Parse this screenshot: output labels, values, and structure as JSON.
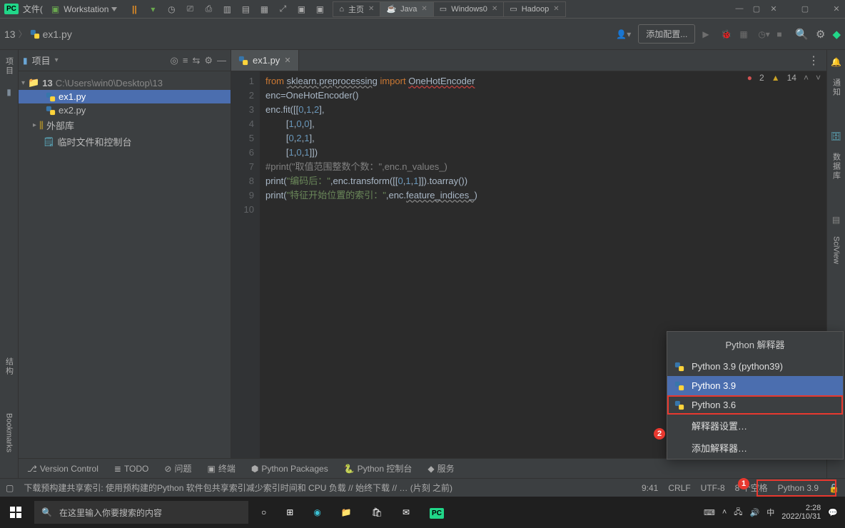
{
  "host_titlebar": {
    "pc_badge": "PC",
    "file_label": "文件("
  },
  "top_tabs": {
    "workstation": {
      "label": "Workstation",
      "has_dropdown": true
    },
    "icons": [
      "pause",
      "resume",
      "clock-icon",
      "picture-icon",
      "printer-icon",
      "layout1-icon",
      "layout2-icon",
      "layout3-icon",
      "expand-icon",
      "terminal1-icon",
      "terminal2-icon"
    ],
    "tabs": [
      {
        "label": "主页",
        "icon": "home-icon",
        "active": false
      },
      {
        "label": "Java",
        "icon": "java-icon",
        "active": true
      },
      {
        "label": "Windows0",
        "icon": "window-icon",
        "active": false
      },
      {
        "label": "Hadoop",
        "icon": "hadoop-icon",
        "active": false
      }
    ]
  },
  "breadcrumb": {
    "root": "13",
    "file": "ex1.py"
  },
  "toolbar": {
    "add_config": "添加配置..."
  },
  "project_panel": {
    "title": "项目",
    "root": {
      "name": "13",
      "path": "C:\\Users\\win0\\Desktop\\13"
    },
    "files": [
      "ex1.py",
      "ex2.py"
    ],
    "ext_lib": "外部库",
    "scratch": "临时文件和控制台"
  },
  "editor": {
    "tab_label": "ex1.py",
    "inspection": {
      "errors": "2",
      "warnings": "14"
    },
    "lines": [
      {
        "n": "1",
        "raw": "from sklearn.preprocessing import OneHotEncoder"
      },
      {
        "n": "2",
        "raw": "enc=OneHotEncoder()"
      },
      {
        "n": "3",
        "raw": "enc.fit([[0,1,2],"
      },
      {
        "n": "4",
        "raw": "        [1,0,0],"
      },
      {
        "n": "5",
        "raw": "        [0,2,1],"
      },
      {
        "n": "6",
        "raw": "        [1,0,1]])"
      },
      {
        "n": "7",
        "raw": "#print(\"取值范围整数个数：\",enc.n_values_)"
      },
      {
        "n": "8",
        "raw": "print(\"编码后：\",enc.transform([[0,1,1]]).toarray())"
      },
      {
        "n": "9",
        "raw": "print(\"特征开始位置的索引：\",enc.feature_indices_)"
      },
      {
        "n": "10",
        "raw": ""
      }
    ]
  },
  "left_sidebar": {
    "project_vtab": "项目",
    "structure": "结构",
    "bookmarks": "Bookmarks"
  },
  "right_sidebar": {
    "notify": "通知",
    "db": "数据库",
    "sciview": "SciView"
  },
  "bottom_tools": {
    "version_control": "Version Control",
    "todo": "TODO",
    "problems": "问题",
    "terminal": "终端",
    "packages": "Python Packages",
    "console": "Python 控制台",
    "services": "服务"
  },
  "status": {
    "message": "下载预构建共享索引: 使用预构建的Python 软件包共享索引减少索引时间和 CPU 负载 // 始终下载 // … (片刻 之前)",
    "pos": "9:41",
    "sep": "CRLF",
    "enc": "UTF-8",
    "indent": "8 个空格",
    "interpreter": "Python 3.9"
  },
  "interpreter_popup": {
    "title": "Python 解释器",
    "items": [
      {
        "label": "Python 3.9 (python39)",
        "selected": false
      },
      {
        "label": "Python 3.9",
        "selected": true
      },
      {
        "label": "Python 3.6",
        "selected": false,
        "boxed": true
      }
    ],
    "settings": "解释器设置…",
    "add": "添加解释器…"
  },
  "annotations": {
    "bubble1": "1",
    "bubble2": "2"
  },
  "taskbar": {
    "search_placeholder": "在这里输入你要搜索的内容",
    "time": "2:28",
    "date": "2022/10/31",
    "ime": "中"
  }
}
